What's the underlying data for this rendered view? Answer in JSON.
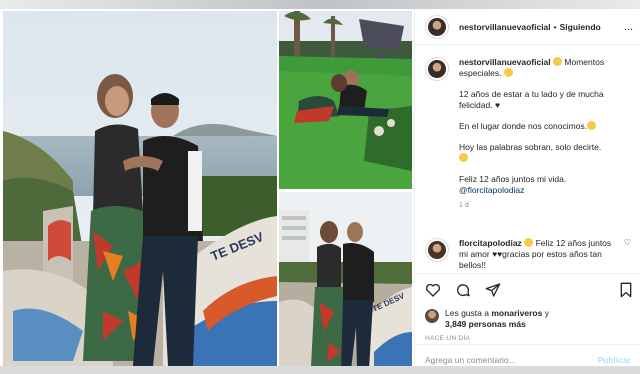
{
  "post": {
    "username": "nestorvillanuevaoficial",
    "separator": "•",
    "follow_state": "Siguiendo",
    "more_label": "...",
    "caption": {
      "line1": "Momentos especiales.",
      "line2": "12 años de estar a tu lado y de mucha felicidad.",
      "line3": "En el lugar donde nos conocimos.",
      "line4": "Hoy las palabras sobran, solo decirte.",
      "line5": "Feliz 12 años juntos mi vida.",
      "mention": "@florcitapolodiaz",
      "time": "1 d"
    },
    "comment": {
      "username": "florcitapolodiaz",
      "text": "Feliz 12 años juntos mi amor",
      "text2": "gracias por estos años tan bellos!!"
    },
    "likes": {
      "prefix": "Les gusta a",
      "user": "monariveros",
      "suffix": "y",
      "count": "3,849 personas más"
    },
    "timestamp": "HACE UN DÍA",
    "add_comment_placeholder": "Agrega un comentario...",
    "publish_label": "Publicar"
  },
  "photos": {
    "wall_text": "TE DESV"
  },
  "colors": {
    "link": "#00376b",
    "muted": "#8e8e8e",
    "publish": "#b2dffc",
    "text": "#262626"
  }
}
